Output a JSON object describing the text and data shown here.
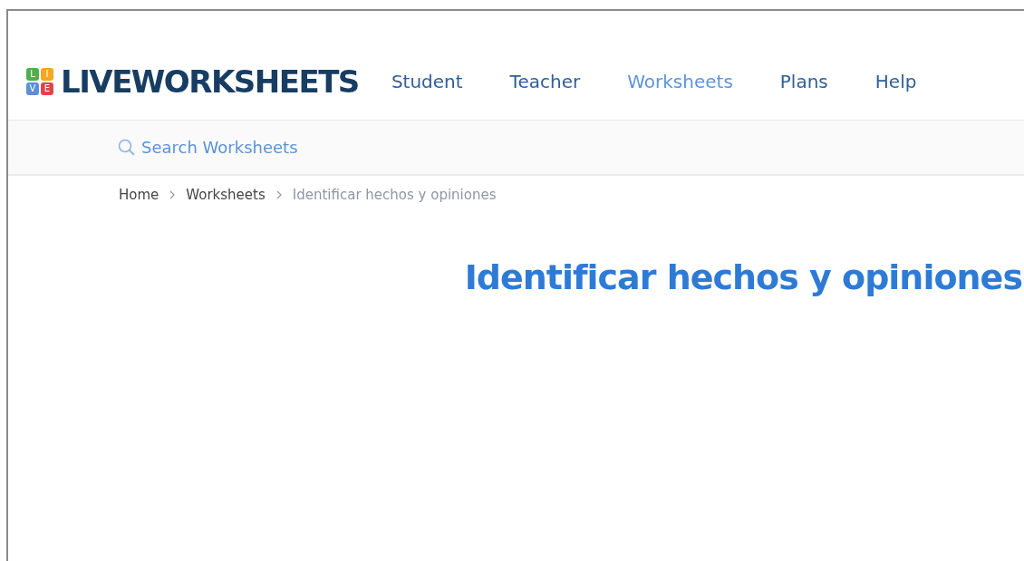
{
  "logo": {
    "tiles": [
      {
        "letter": "L",
        "color": "#4caf50"
      },
      {
        "letter": "I",
        "color": "#f5a623"
      },
      {
        "letter": "V",
        "color": "#5b8fd6"
      },
      {
        "letter": "E",
        "color": "#e0454a"
      }
    ],
    "text": "LIVEWORKSHEETS"
  },
  "nav": [
    {
      "label": "Student",
      "selected": false
    },
    {
      "label": "Teacher",
      "selected": false
    },
    {
      "label": "Worksheets",
      "selected": true
    },
    {
      "label": "Plans",
      "selected": false
    },
    {
      "label": "Help",
      "selected": false
    }
  ],
  "search": {
    "placeholder": "Search Worksheets"
  },
  "breadcrumbs": [
    {
      "label": "Home",
      "current": false
    },
    {
      "label": "Worksheets",
      "current": false
    },
    {
      "label": "Identificar hechos y opiniones",
      "current": true
    }
  ],
  "title": "Identificar hechos y opiniones"
}
